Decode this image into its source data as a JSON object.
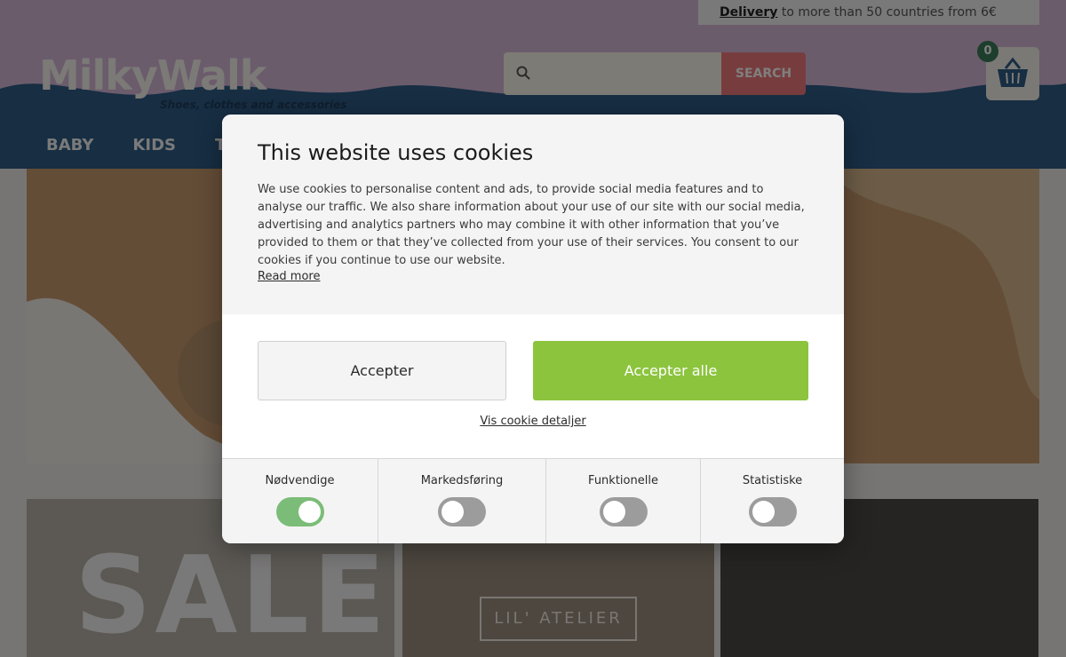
{
  "header": {
    "delivery_link": "Delivery",
    "delivery_text": " to more than 50 countries from 6€",
    "logo_text": "MilkyWalk",
    "tagline": "Shoes, clothes and accessories",
    "search_button": "SEARCH",
    "search_placeholder": "",
    "cart_count": "0",
    "nav": [
      "BABY",
      "KIDS",
      "T"
    ]
  },
  "page": {
    "sale_text": "SALE",
    "atelier_text": "LIL' ATELIER"
  },
  "cookie_dialog": {
    "title": "This website uses cookies",
    "body": "We use cookies to personalise content and ads, to provide social media features and to analyse our traffic. We also share information about your use of our site with our social media, advertising and analytics partners who may combine it with other information that you’ve provided to them or that they’ve collected from your use of their services. You consent to our cookies if you continue to use our website.",
    "read_more": "Read more",
    "accept_button": "Accepter",
    "accept_all_button": "Accepter alle",
    "details_link": "Vis cookie detaljer",
    "categories": [
      {
        "label": "Nødvendige",
        "enabled": true
      },
      {
        "label": "Markedsføring",
        "enabled": false
      },
      {
        "label": "Funktionelle",
        "enabled": false
      },
      {
        "label": "Statistiske",
        "enabled": false
      }
    ]
  },
  "colors": {
    "accept_all": "#8cc43e",
    "toggle_on": "#7bbd78",
    "toggle_off": "#9c9c9c"
  }
}
